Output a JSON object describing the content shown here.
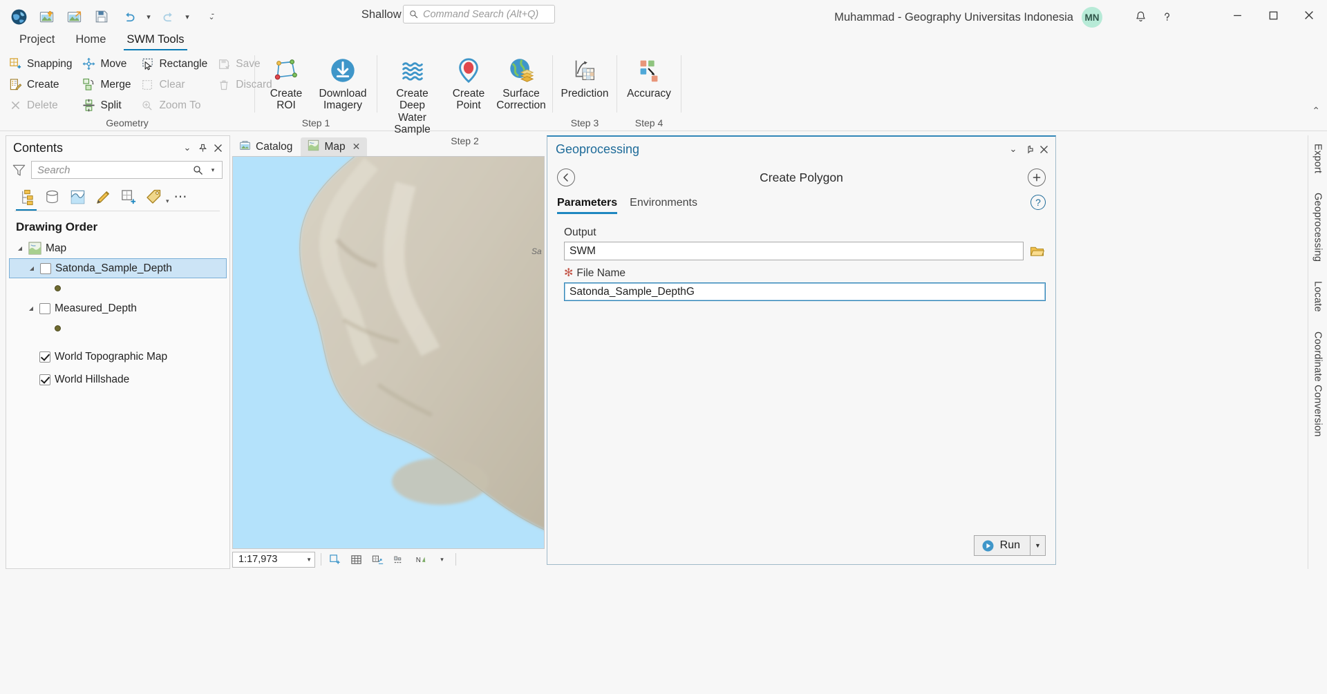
{
  "titlebar": {
    "app_title": "Shallow Water Mapper",
    "command_search_placeholder": "Command Search (Alt+Q)",
    "account_name": "Muhammad - Geography Universitas Indonesia",
    "avatar_initials": "MN",
    "quick_access": [
      {
        "name": "arcgis-globe-logo",
        "label": "ArcGIS Pro"
      },
      {
        "name": "new-project-icon",
        "label": "New Project"
      },
      {
        "name": "open-project-icon",
        "label": "Open Project"
      },
      {
        "name": "save-project-icon",
        "label": "Save Project"
      },
      {
        "name": "undo-icon",
        "label": "Undo"
      },
      {
        "name": "redo-icon",
        "label": "Redo"
      },
      {
        "name": "customize-qat-icon",
        "label": "Customize Quick Access Toolbar"
      }
    ],
    "notifications_label": "Notifications",
    "help_label": "Help",
    "minimize_label": "Minimize",
    "maximize_label": "Restore Down",
    "close_label": "Close"
  },
  "ribbon": {
    "tabs": [
      {
        "label": "Project",
        "active": false
      },
      {
        "label": "Home",
        "active": false
      },
      {
        "label": "SWM Tools",
        "active": true
      }
    ],
    "groups": [
      {
        "label": "Geometry",
        "columns": [
          [
            {
              "label": "Snapping",
              "icon": "snapping-icon",
              "disabled": false
            },
            {
              "label": "Create",
              "icon": "create-feature-icon",
              "disabled": false
            },
            {
              "label": "Delete",
              "icon": "delete-icon",
              "disabled": true
            }
          ],
          [
            {
              "label": "Move",
              "icon": "move-icon",
              "disabled": false
            },
            {
              "label": "Merge",
              "icon": "merge-icon",
              "disabled": false
            },
            {
              "label": "Split",
              "icon": "split-icon",
              "disabled": false
            }
          ],
          [
            {
              "label": "Rectangle",
              "icon": "rectangle-select-icon",
              "disabled": false
            },
            {
              "label": "Clear",
              "icon": "clear-selection-icon",
              "disabled": true
            },
            {
              "label": "Zoom To",
              "icon": "zoom-to-selection-icon",
              "disabled": true
            }
          ],
          [
            {
              "label": "Save",
              "icon": "save-edits-icon",
              "disabled": true
            },
            {
              "label": "Discard",
              "icon": "discard-edits-icon",
              "disabled": true
            }
          ]
        ]
      },
      {
        "label": "Step 1",
        "buttons": [
          {
            "label": "Create ROI",
            "icon": "create-roi-icon"
          },
          {
            "label": "Download Imagery",
            "icon": "download-imagery-icon"
          }
        ]
      },
      {
        "label": "Step 2",
        "buttons": [
          {
            "label": "Create Deep Water Sample",
            "icon": "deep-water-sample-icon"
          },
          {
            "label": "Create Point",
            "icon": "create-point-icon"
          },
          {
            "label": "Surface Correction",
            "icon": "surface-correction-icon"
          }
        ]
      },
      {
        "label": "Step 3",
        "buttons": [
          {
            "label": "Prediction",
            "icon": "prediction-icon"
          }
        ]
      },
      {
        "label": "Step 4",
        "buttons": [
          {
            "label": "Accuracy",
            "icon": "accuracy-icon"
          }
        ]
      }
    ],
    "collapse_label": "Collapse the Ribbon"
  },
  "contents": {
    "title": "Contents",
    "search_placeholder": "Search",
    "dropdown_label": "Collapse",
    "pin_label": "Auto Hide",
    "close_label": "Close",
    "filter_label": "Filter",
    "search_icon_label": "Search",
    "search_options_label": "Search Options",
    "toolbar": [
      {
        "name": "list-by-drawing-order-icon",
        "selected": true
      },
      {
        "name": "list-by-data-source-icon",
        "selected": false
      },
      {
        "name": "list-by-selection-icon",
        "selected": false
      },
      {
        "name": "list-by-editing-icon",
        "selected": false
      },
      {
        "name": "list-by-snapping-icon",
        "selected": false
      },
      {
        "name": "list-by-labeling-icon",
        "selected": false
      }
    ],
    "more_label": "More",
    "section_title": "Drawing Order",
    "tree": [
      {
        "label": "Map",
        "type": "map",
        "level": 0,
        "expandable": true,
        "checkbox": null
      },
      {
        "label": "Satonda_Sample_Depth",
        "type": "layer",
        "level": 1,
        "expandable": true,
        "checkbox": false,
        "selected": true
      },
      {
        "label": "",
        "type": "symbol",
        "level": 2,
        "expandable": false,
        "checkbox": null
      },
      {
        "label": "Measured_Depth",
        "type": "layer",
        "level": 1,
        "expandable": true,
        "checkbox": false,
        "selected": false
      },
      {
        "label": "",
        "type": "symbol",
        "level": 2,
        "expandable": false,
        "checkbox": null
      },
      {
        "label": "World Topographic Map",
        "type": "basemap",
        "level": 1,
        "expandable": false,
        "checkbox": true,
        "selected": false
      },
      {
        "label": "World Hillshade",
        "type": "basemap",
        "level": 1,
        "expandable": false,
        "checkbox": true,
        "selected": false
      }
    ]
  },
  "mapview": {
    "tabs": [
      {
        "label": "Catalog",
        "icon": "catalog-icon",
        "active": false,
        "closable": false
      },
      {
        "label": "Map",
        "icon": "map-icon",
        "active": true,
        "closable": true
      }
    ],
    "scale": "1:17,973",
    "scale_dropdown_label": "Select Scale",
    "water_label": "Sa",
    "status_icons": [
      {
        "name": "selected-features-icon"
      },
      {
        "name": "attribute-table-icon"
      },
      {
        "name": "map-coordinate-icon"
      },
      {
        "name": "drawing-status-icon"
      },
      {
        "name": "north-arrow-icon"
      },
      {
        "name": "status-dropdown-icon"
      }
    ]
  },
  "geoprocessing": {
    "title": "Geoprocessing",
    "tool_name": "Create Polygon",
    "back_label": "Back",
    "add_label": "Add to Model",
    "help_label": "Help",
    "dropdown_label": "Menu",
    "pin_label": "Auto Hide",
    "close_label": "Close",
    "tabs": [
      {
        "label": "Parameters",
        "active": true
      },
      {
        "label": "Environments",
        "active": false
      }
    ],
    "fields": [
      {
        "label": "Output",
        "value": "SWM",
        "required": false,
        "has_browse": true,
        "focused": false,
        "browse_label": "Browse"
      },
      {
        "label": "File Name",
        "value": "Satonda_Sample_DepthG",
        "required": true,
        "has_browse": false,
        "focused": true
      }
    ],
    "run_label": "Run",
    "run_dropdown_label": "Run options"
  },
  "vertical_dock": {
    "tabs": [
      {
        "label": "Export"
      },
      {
        "label": "Geoprocessing"
      },
      {
        "label": "Locate"
      },
      {
        "label": "Coordinate Conversion"
      }
    ]
  },
  "colors": {
    "accent": "#0b7bb5",
    "gp_title": "#1e6b99",
    "selection": "#cce4f6",
    "required": "#c4584b",
    "water": "#b4e2fb",
    "land": "#cfc9bc",
    "avatar_bg": "#b7ead7"
  }
}
